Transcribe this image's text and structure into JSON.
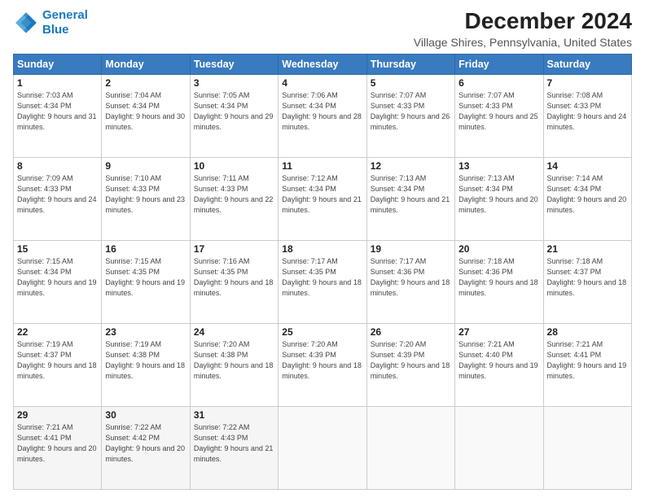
{
  "header": {
    "logo_line1": "General",
    "logo_line2": "Blue",
    "title": "December 2024",
    "subtitle": "Village Shires, Pennsylvania, United States"
  },
  "days_of_week": [
    "Sunday",
    "Monday",
    "Tuesday",
    "Wednesday",
    "Thursday",
    "Friday",
    "Saturday"
  ],
  "weeks": [
    [
      {
        "day": "1",
        "sunrise": "Sunrise: 7:03 AM",
        "sunset": "Sunset: 4:34 PM",
        "daylight": "Daylight: 9 hours and 31 minutes."
      },
      {
        "day": "2",
        "sunrise": "Sunrise: 7:04 AM",
        "sunset": "Sunset: 4:34 PM",
        "daylight": "Daylight: 9 hours and 30 minutes."
      },
      {
        "day": "3",
        "sunrise": "Sunrise: 7:05 AM",
        "sunset": "Sunset: 4:34 PM",
        "daylight": "Daylight: 9 hours and 29 minutes."
      },
      {
        "day": "4",
        "sunrise": "Sunrise: 7:06 AM",
        "sunset": "Sunset: 4:34 PM",
        "daylight": "Daylight: 9 hours and 28 minutes."
      },
      {
        "day": "5",
        "sunrise": "Sunrise: 7:07 AM",
        "sunset": "Sunset: 4:33 PM",
        "daylight": "Daylight: 9 hours and 26 minutes."
      },
      {
        "day": "6",
        "sunrise": "Sunrise: 7:07 AM",
        "sunset": "Sunset: 4:33 PM",
        "daylight": "Daylight: 9 hours and 25 minutes."
      },
      {
        "day": "7",
        "sunrise": "Sunrise: 7:08 AM",
        "sunset": "Sunset: 4:33 PM",
        "daylight": "Daylight: 9 hours and 24 minutes."
      }
    ],
    [
      {
        "day": "8",
        "sunrise": "Sunrise: 7:09 AM",
        "sunset": "Sunset: 4:33 PM",
        "daylight": "Daylight: 9 hours and 24 minutes."
      },
      {
        "day": "9",
        "sunrise": "Sunrise: 7:10 AM",
        "sunset": "Sunset: 4:33 PM",
        "daylight": "Daylight: 9 hours and 23 minutes."
      },
      {
        "day": "10",
        "sunrise": "Sunrise: 7:11 AM",
        "sunset": "Sunset: 4:33 PM",
        "daylight": "Daylight: 9 hours and 22 minutes."
      },
      {
        "day": "11",
        "sunrise": "Sunrise: 7:12 AM",
        "sunset": "Sunset: 4:34 PM",
        "daylight": "Daylight: 9 hours and 21 minutes."
      },
      {
        "day": "12",
        "sunrise": "Sunrise: 7:13 AM",
        "sunset": "Sunset: 4:34 PM",
        "daylight": "Daylight: 9 hours and 21 minutes."
      },
      {
        "day": "13",
        "sunrise": "Sunrise: 7:13 AM",
        "sunset": "Sunset: 4:34 PM",
        "daylight": "Daylight: 9 hours and 20 minutes."
      },
      {
        "day": "14",
        "sunrise": "Sunrise: 7:14 AM",
        "sunset": "Sunset: 4:34 PM",
        "daylight": "Daylight: 9 hours and 20 minutes."
      }
    ],
    [
      {
        "day": "15",
        "sunrise": "Sunrise: 7:15 AM",
        "sunset": "Sunset: 4:34 PM",
        "daylight": "Daylight: 9 hours and 19 minutes."
      },
      {
        "day": "16",
        "sunrise": "Sunrise: 7:15 AM",
        "sunset": "Sunset: 4:35 PM",
        "daylight": "Daylight: 9 hours and 19 minutes."
      },
      {
        "day": "17",
        "sunrise": "Sunrise: 7:16 AM",
        "sunset": "Sunset: 4:35 PM",
        "daylight": "Daylight: 9 hours and 18 minutes."
      },
      {
        "day": "18",
        "sunrise": "Sunrise: 7:17 AM",
        "sunset": "Sunset: 4:35 PM",
        "daylight": "Daylight: 9 hours and 18 minutes."
      },
      {
        "day": "19",
        "sunrise": "Sunrise: 7:17 AM",
        "sunset": "Sunset: 4:36 PM",
        "daylight": "Daylight: 9 hours and 18 minutes."
      },
      {
        "day": "20",
        "sunrise": "Sunrise: 7:18 AM",
        "sunset": "Sunset: 4:36 PM",
        "daylight": "Daylight: 9 hours and 18 minutes."
      },
      {
        "day": "21",
        "sunrise": "Sunrise: 7:18 AM",
        "sunset": "Sunset: 4:37 PM",
        "daylight": "Daylight: 9 hours and 18 minutes."
      }
    ],
    [
      {
        "day": "22",
        "sunrise": "Sunrise: 7:19 AM",
        "sunset": "Sunset: 4:37 PM",
        "daylight": "Daylight: 9 hours and 18 minutes."
      },
      {
        "day": "23",
        "sunrise": "Sunrise: 7:19 AM",
        "sunset": "Sunset: 4:38 PM",
        "daylight": "Daylight: 9 hours and 18 minutes."
      },
      {
        "day": "24",
        "sunrise": "Sunrise: 7:20 AM",
        "sunset": "Sunset: 4:38 PM",
        "daylight": "Daylight: 9 hours and 18 minutes."
      },
      {
        "day": "25",
        "sunrise": "Sunrise: 7:20 AM",
        "sunset": "Sunset: 4:39 PM",
        "daylight": "Daylight: 9 hours and 18 minutes."
      },
      {
        "day": "26",
        "sunrise": "Sunrise: 7:20 AM",
        "sunset": "Sunset: 4:39 PM",
        "daylight": "Daylight: 9 hours and 18 minutes."
      },
      {
        "day": "27",
        "sunrise": "Sunrise: 7:21 AM",
        "sunset": "Sunset: 4:40 PM",
        "daylight": "Daylight: 9 hours and 19 minutes."
      },
      {
        "day": "28",
        "sunrise": "Sunrise: 7:21 AM",
        "sunset": "Sunset: 4:41 PM",
        "daylight": "Daylight: 9 hours and 19 minutes."
      }
    ],
    [
      {
        "day": "29",
        "sunrise": "Sunrise: 7:21 AM",
        "sunset": "Sunset: 4:41 PM",
        "daylight": "Daylight: 9 hours and 20 minutes."
      },
      {
        "day": "30",
        "sunrise": "Sunrise: 7:22 AM",
        "sunset": "Sunset: 4:42 PM",
        "daylight": "Daylight: 9 hours and 20 minutes."
      },
      {
        "day": "31",
        "sunrise": "Sunrise: 7:22 AM",
        "sunset": "Sunset: 4:43 PM",
        "daylight": "Daylight: 9 hours and 21 minutes."
      },
      null,
      null,
      null,
      null
    ]
  ]
}
